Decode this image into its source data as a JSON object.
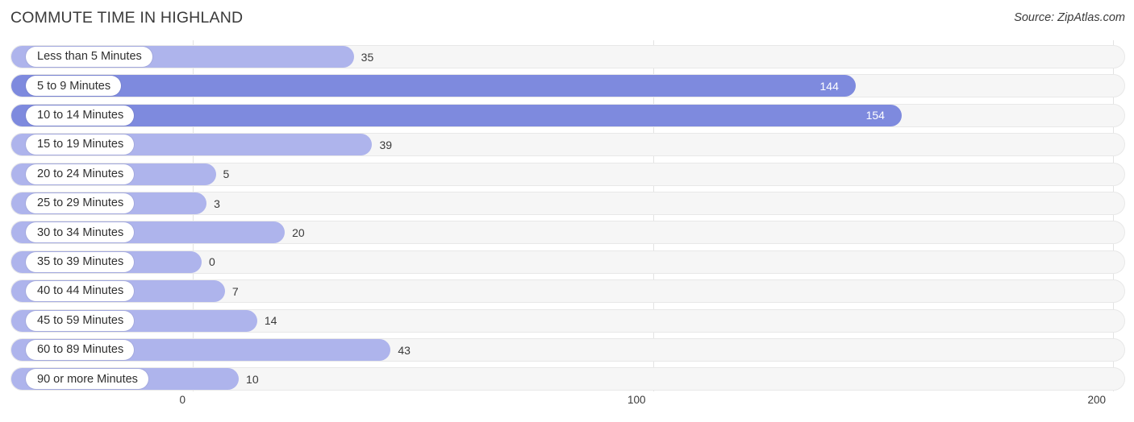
{
  "header": {
    "title": "COMMUTE TIME IN HIGHLAND",
    "source": "Source: ZipAtlas.com"
  },
  "colors": {
    "bar_light": "#aeb4ec",
    "bar_dark": "#7e8ade",
    "track": "#f6f6f6",
    "gridline": "#e3e3e3",
    "text": "#3a3a3a"
  },
  "chart_data": {
    "type": "bar",
    "orientation": "horizontal",
    "title": "COMMUTE TIME IN HIGHLAND",
    "subtitle": "",
    "xlabel": "",
    "ylabel": "",
    "source": "Source: ZipAtlas.com",
    "xlim": [
      0,
      200
    ],
    "xticks": [
      0,
      100,
      200
    ],
    "xtick_labels": [
      "0",
      "100",
      "200"
    ],
    "grid": true,
    "legend": false,
    "categories": [
      "Less than 5 Minutes",
      "5 to 9 Minutes",
      "10 to 14 Minutes",
      "15 to 19 Minutes",
      "20 to 24 Minutes",
      "25 to 29 Minutes",
      "30 to 34 Minutes",
      "35 to 39 Minutes",
      "40 to 44 Minutes",
      "45 to 59 Minutes",
      "60 to 89 Minutes",
      "90 or more Minutes"
    ],
    "values": [
      35,
      144,
      154,
      39,
      5,
      3,
      20,
      0,
      7,
      14,
      43,
      10
    ],
    "value_labels": [
      "35",
      "144",
      "154",
      "39",
      "5",
      "3",
      "20",
      "0",
      "7",
      "14",
      "43",
      "10"
    ]
  },
  "rows": [
    {
      "label": "Less than 5 Minutes",
      "value": 35,
      "value_label": "35",
      "shade": "light",
      "label_inside": false
    },
    {
      "label": "5 to 9 Minutes",
      "value": 144,
      "value_label": "144",
      "shade": "dark",
      "label_inside": true
    },
    {
      "label": "10 to 14 Minutes",
      "value": 154,
      "value_label": "154",
      "shade": "dark",
      "label_inside": true
    },
    {
      "label": "15 to 19 Minutes",
      "value": 39,
      "value_label": "39",
      "shade": "light",
      "label_inside": false
    },
    {
      "label": "20 to 24 Minutes",
      "value": 5,
      "value_label": "5",
      "shade": "light",
      "label_inside": false
    },
    {
      "label": "25 to 29 Minutes",
      "value": 3,
      "value_label": "3",
      "shade": "light",
      "label_inside": false
    },
    {
      "label": "30 to 34 Minutes",
      "value": 20,
      "value_label": "20",
      "shade": "light",
      "label_inside": false
    },
    {
      "label": "35 to 39 Minutes",
      "value": 0,
      "value_label": "0",
      "shade": "light",
      "label_inside": false
    },
    {
      "label": "40 to 44 Minutes",
      "value": 7,
      "value_label": "7",
      "shade": "light",
      "label_inside": false
    },
    {
      "label": "45 to 59 Minutes",
      "value": 14,
      "value_label": "14",
      "shade": "light",
      "label_inside": false
    },
    {
      "label": "60 to 89 Minutes",
      "value": 43,
      "value_label": "43",
      "shade": "light",
      "label_inside": false
    },
    {
      "label": "90 or more Minutes",
      "value": 10,
      "value_label": "10",
      "shade": "light",
      "label_inside": false
    }
  ],
  "axis": {
    "ticks": [
      {
        "label": "0",
        "value": 0
      },
      {
        "label": "100",
        "value": 100
      },
      {
        "label": "200",
        "value": 200
      }
    ]
  }
}
